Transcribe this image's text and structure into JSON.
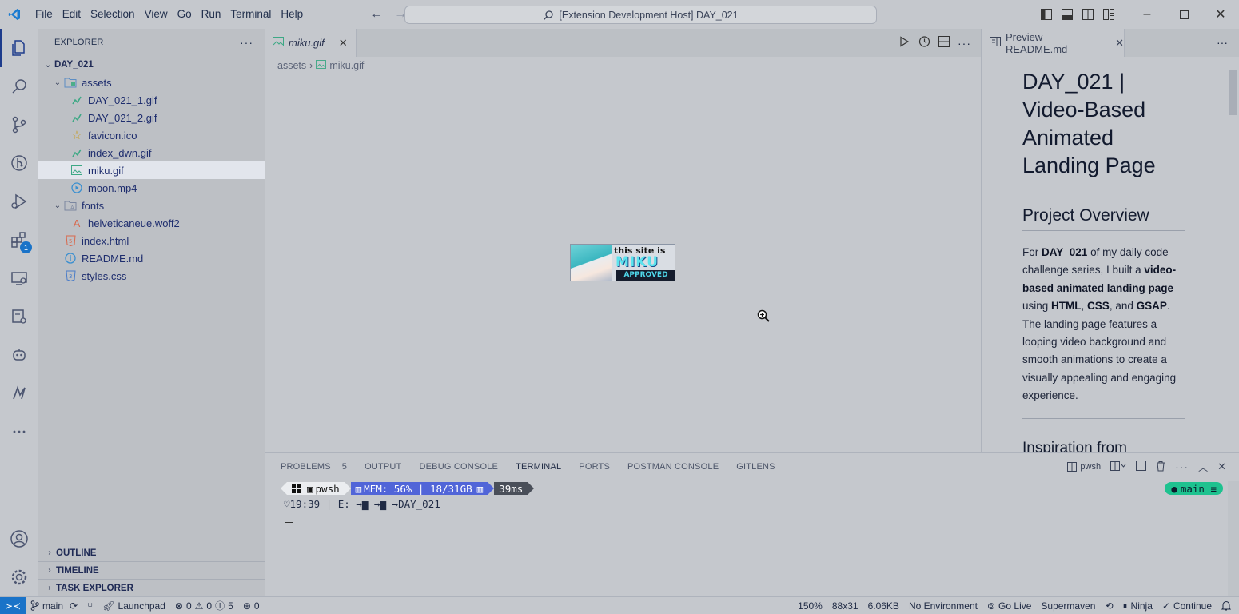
{
  "titlebar": {
    "menu": [
      "File",
      "Edit",
      "Selection",
      "View",
      "Go",
      "Run",
      "Terminal",
      "Help"
    ],
    "command_center": "[Extension Development Host] DAY_021",
    "window_controls": [
      "minimize",
      "maximize",
      "close"
    ]
  },
  "activity_bar": {
    "items": [
      "explorer-icon",
      "search-icon",
      "source-control-icon",
      "gitlens-icon",
      "run-debug-icon",
      "extensions-icon",
      "remote-explorer-icon",
      "postman-icon",
      "copilot-icon",
      "supermaven-icon",
      "more-icon"
    ],
    "extensions_badge": "1",
    "bottom": [
      "account-icon",
      "settings-gear-icon"
    ]
  },
  "sidebar": {
    "title": "EXPLORER",
    "more": "···",
    "root": "DAY_021",
    "tree": [
      {
        "label": "assets",
        "type": "folder",
        "depth": 1
      },
      {
        "label": "DAY_021_1.gif",
        "type": "gif",
        "depth": 2
      },
      {
        "label": "DAY_021_2.gif",
        "type": "gif",
        "depth": 2
      },
      {
        "label": "favicon.ico",
        "type": "ico",
        "depth": 2
      },
      {
        "label": "index_dwn.gif",
        "type": "gif",
        "depth": 2
      },
      {
        "label": "miku.gif",
        "type": "image",
        "depth": 2,
        "selected": true
      },
      {
        "label": "moon.mp4",
        "type": "video",
        "depth": 2
      },
      {
        "label": "fonts",
        "type": "folder",
        "depth": 1
      },
      {
        "label": "helveticaneue.woff2",
        "type": "font",
        "depth": 2
      },
      {
        "label": "index.html",
        "type": "html",
        "depth": 1
      },
      {
        "label": "README.md",
        "type": "md",
        "depth": 1
      },
      {
        "label": "styles.css",
        "type": "css",
        "depth": 1
      }
    ],
    "sections": [
      "OUTLINE",
      "TIMELINE",
      "TASK EXPLORER"
    ]
  },
  "editor": {
    "tab": "miku.gif",
    "breadcrumb": [
      "assets",
      "miku.gif"
    ],
    "image": {
      "line1": "this site is",
      "line2": "MIKU",
      "line3": "APPROVED"
    }
  },
  "preview": {
    "tab": "Preview README.md",
    "h1": "DAY_021 | Video-Based Animated Landing Page",
    "h2": "Project Overview",
    "p_parts": {
      "a": "For ",
      "b": "DAY_021",
      "c": " of my daily code challenge series, I built a ",
      "d": "video-based animated landing page",
      "e": " using ",
      "f": "HTML",
      "g": ", ",
      "h": "CSS",
      "i": ", and ",
      "j": "GSAP",
      "k": ". The landing page features a looping video background and smooth animations to create a visually appealing and engaging experience."
    },
    "h2b": "Inspiration from"
  },
  "panel": {
    "tabs": [
      {
        "label": "PROBLEMS",
        "count": "5"
      },
      {
        "label": "OUTPUT"
      },
      {
        "label": "DEBUG CONSOLE"
      },
      {
        "label": "TERMINAL",
        "active": true
      },
      {
        "label": "PORTS"
      },
      {
        "label": "POSTMAN CONSOLE"
      },
      {
        "label": "GITLENS"
      }
    ],
    "terminal_name": "pwsh",
    "prompt": {
      "shell": "pwsh",
      "mem": "MEM: 56% | 18/31GB",
      "time": "39ms",
      "line2_time": "19:39",
      "line2_drive": "E:",
      "line2_dir": "DAY_021",
      "git_branch": "main ≡"
    }
  },
  "statusbar": {
    "branch": "main",
    "launchpad": "Launchpad",
    "errors": "0",
    "warnings": "0",
    "infos": "0",
    "problems": "5",
    "ports": "0",
    "zoom": "150%",
    "dims": "88x31",
    "size": "6.06KB",
    "env": "No Environment",
    "golive": "Go Live",
    "supermaven": "Supermaven",
    "ninja": "Ninja",
    "continue": "Continue"
  },
  "colors": {
    "accent": "#1a73c8",
    "terminal_mem": "#5165d8",
    "git_segment": "#1ec28f"
  }
}
